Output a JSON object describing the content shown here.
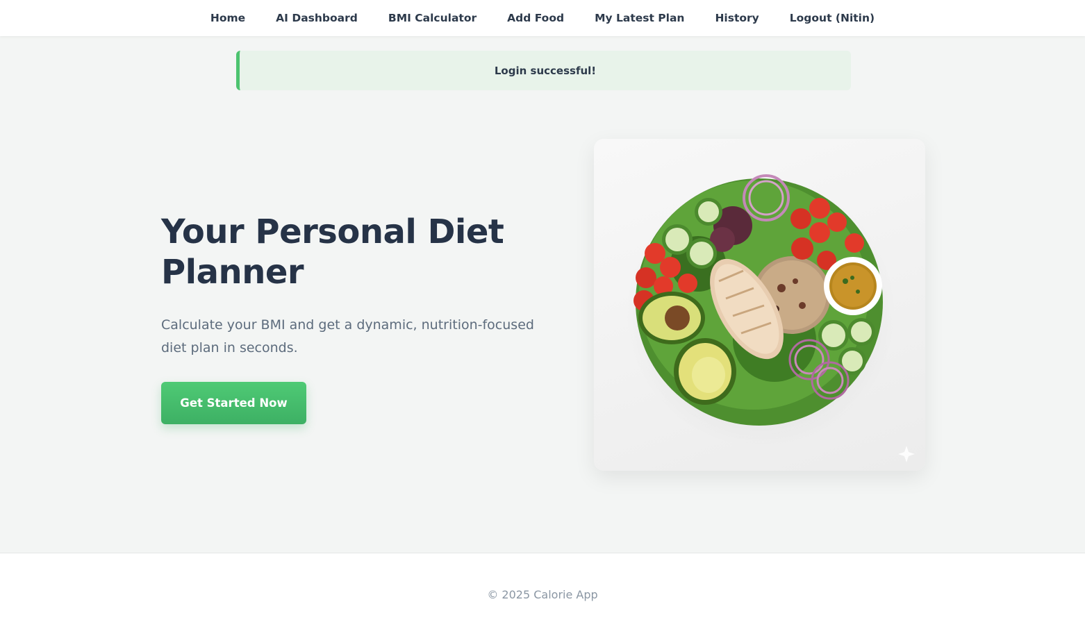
{
  "nav": {
    "items": [
      {
        "label": "Home"
      },
      {
        "label": "AI Dashboard"
      },
      {
        "label": "BMI Calculator"
      },
      {
        "label": "Add Food"
      },
      {
        "label": "My Latest Plan"
      },
      {
        "label": "History"
      },
      {
        "label": "Logout (Nitin)"
      }
    ]
  },
  "alert": {
    "message": "Login successful!",
    "accent_color": "#4cc36f"
  },
  "hero": {
    "title": "Your Personal Diet Planner",
    "subtitle": "Calculate your BMI and get a dynamic, nutrition-focused diet plan in seconds.",
    "cta_label": "Get Started Now",
    "cta_color": "#45bd6b"
  },
  "image": {
    "icon": "salad-bowl-illustration"
  },
  "footer": {
    "copyright": "© 2025 Calorie App"
  }
}
